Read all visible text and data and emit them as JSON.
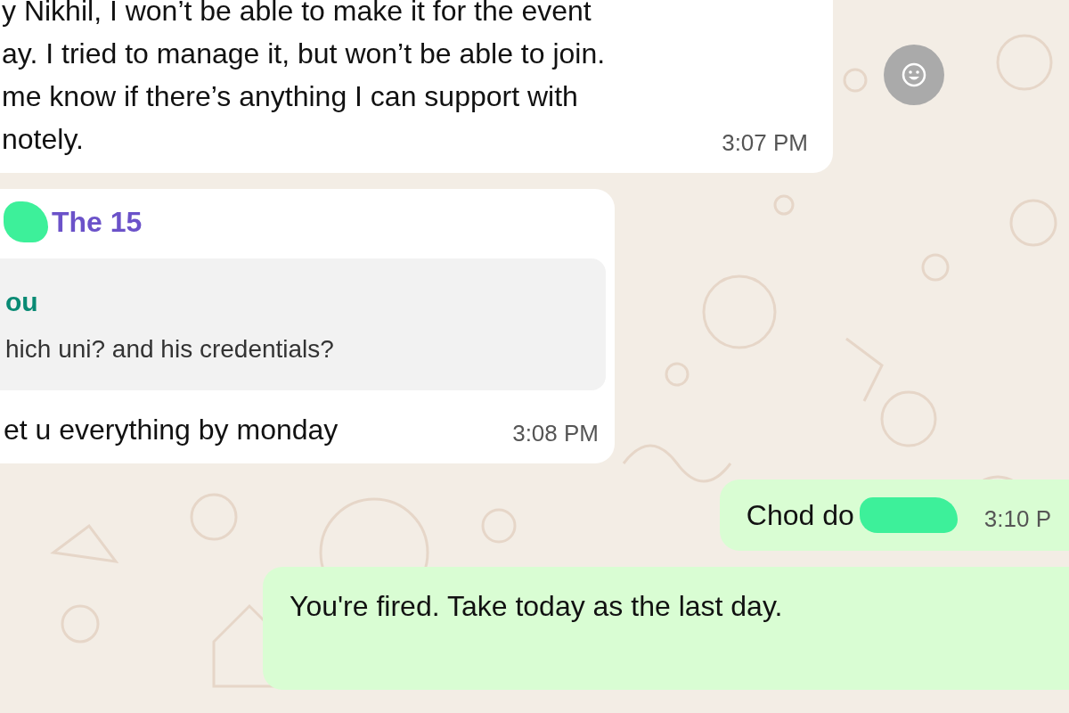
{
  "messages": [
    {
      "kind": "incoming",
      "lines": [
        "y Nikhil, I won’t be able to make it for the event",
        "ay. I tried to manage it, but won’t be able to join.",
        " me know if there’s anything I can support with",
        "notely."
      ],
      "time": "3:07 PM",
      "reaction_button": true
    },
    {
      "kind": "incoming",
      "sender": "The 15",
      "sender_redacted": true,
      "quote": {
        "author": "ou",
        "text": "hich uni? and his credentials?"
      },
      "lines": [
        "et u everything by monday"
      ],
      "time": "3:08 PM",
      "reaction_button": false
    },
    {
      "kind": "outgoing",
      "lines": [
        "Chod do"
      ],
      "redacted_after": true,
      "time": "3:10 P",
      "reaction_button": false
    },
    {
      "kind": "outgoing",
      "lines": [
        "You're fired. Take today as the last day."
      ],
      "reaction_button": false
    }
  ]
}
